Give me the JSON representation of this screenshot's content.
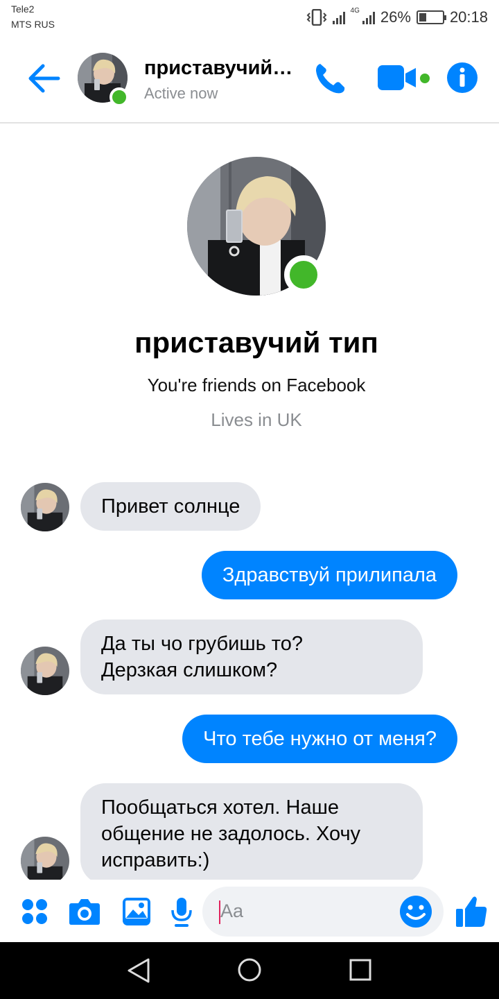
{
  "status_bar": {
    "carrier_line1": "Tele2",
    "carrier_line2": "MTS RUS",
    "network_label": "4G",
    "battery_text": "26%",
    "time": "20:18"
  },
  "header": {
    "contact_name": "приставучий…",
    "status": "Active now",
    "icons": [
      "back-arrow-icon",
      "phone-icon",
      "video-camera-icon",
      "info-icon"
    ]
  },
  "profile": {
    "name": "приставучий тип",
    "friends_text": "You're friends on Facebook",
    "lives_text": "Lives in UK"
  },
  "messages": [
    {
      "direction": "incoming",
      "text": "Привет солнце"
    },
    {
      "direction": "outgoing",
      "text": "Здравствуй прилипала"
    },
    {
      "direction": "incoming",
      "text": "Да ты чо грубишь то?\nДерзкая слишком?"
    },
    {
      "direction": "outgoing",
      "text": "Что тебе нужно от меня?"
    },
    {
      "direction": "incoming",
      "text": "Пообщаться хотел. Наше\nобщение не задолось. Хочу\nисправить:)"
    }
  ],
  "composer": {
    "placeholder": "Aa",
    "icons": [
      "more-apps-icon",
      "camera-icon",
      "gallery-icon",
      "microphone-icon",
      "emoji-icon",
      "thumbs-up-icon"
    ]
  },
  "colors": {
    "accent": "#0084ff",
    "online": "#42b72a",
    "incoming_bubble": "#e4e6eb"
  }
}
